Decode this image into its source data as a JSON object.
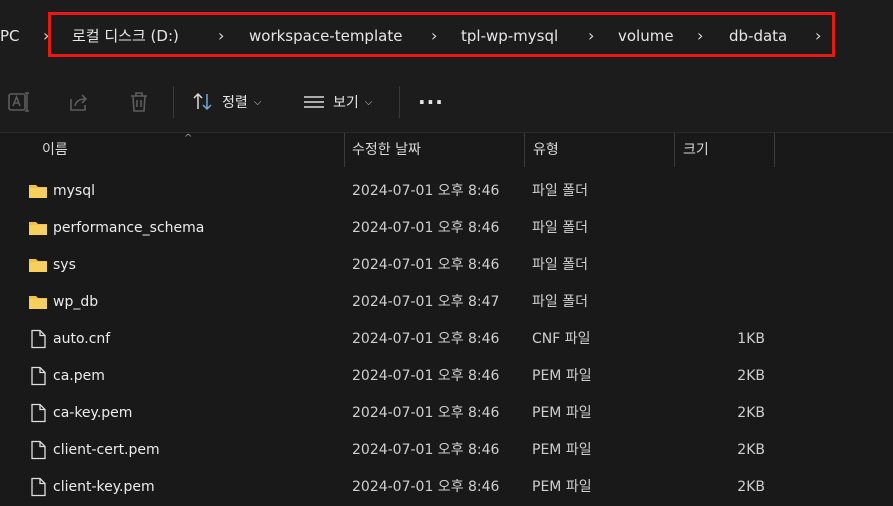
{
  "breadcrumb": {
    "items": [
      "PC",
      "로컬 디스크 (D:)",
      "workspace-template",
      "tpl-wp-mysql",
      "volume",
      "db-data"
    ],
    "separator": "›"
  },
  "toolbar": {
    "sort_label": "정렬",
    "view_label": "보기",
    "more_label": "···"
  },
  "columns": {
    "name": "이름",
    "date": "수정한 날짜",
    "type": "유형",
    "size": "크기"
  },
  "files": [
    {
      "name": "mysql",
      "date": "2024-07-01 오후 8:46",
      "type": "파일 폴더",
      "size": "",
      "kind": "folder"
    },
    {
      "name": "performance_schema",
      "date": "2024-07-01 오후 8:46",
      "type": "파일 폴더",
      "size": "",
      "kind": "folder"
    },
    {
      "name": "sys",
      "date": "2024-07-01 오후 8:46",
      "type": "파일 폴더",
      "size": "",
      "kind": "folder"
    },
    {
      "name": "wp_db",
      "date": "2024-07-01 오후 8:47",
      "type": "파일 폴더",
      "size": "",
      "kind": "folder"
    },
    {
      "name": "auto.cnf",
      "date": "2024-07-01 오후 8:46",
      "type": "CNF 파일",
      "size": "1KB",
      "kind": "file"
    },
    {
      "name": "ca.pem",
      "date": "2024-07-01 오후 8:46",
      "type": "PEM 파일",
      "size": "2KB",
      "kind": "file"
    },
    {
      "name": "ca-key.pem",
      "date": "2024-07-01 오후 8:46",
      "type": "PEM 파일",
      "size": "2KB",
      "kind": "file"
    },
    {
      "name": "client-cert.pem",
      "date": "2024-07-01 오후 8:46",
      "type": "PEM 파일",
      "size": "2KB",
      "kind": "file"
    },
    {
      "name": "client-key.pem",
      "date": "2024-07-01 오후 8:46",
      "type": "PEM 파일",
      "size": "2KB",
      "kind": "file"
    }
  ],
  "colors": {
    "highlight": "#e81818",
    "folder": "#f2c14b",
    "background": "#191919"
  }
}
